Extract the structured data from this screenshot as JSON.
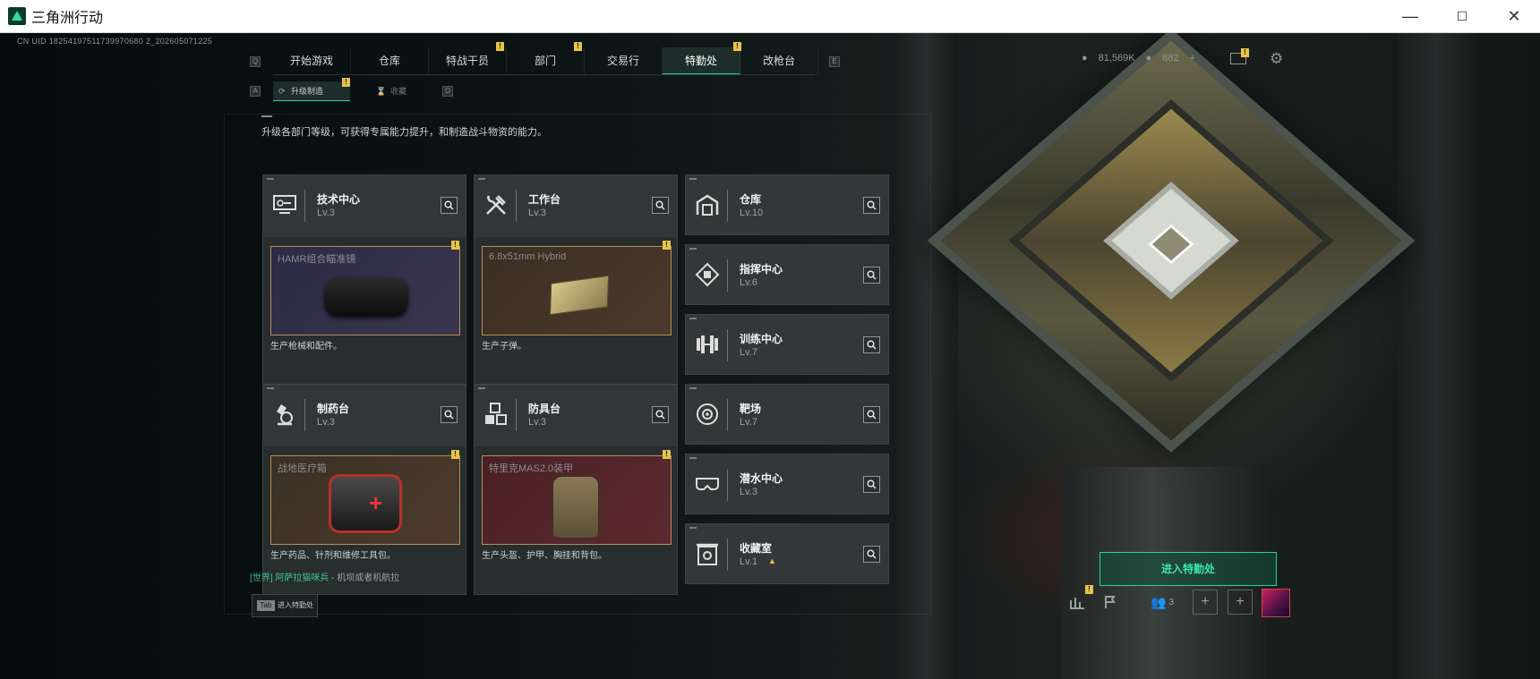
{
  "window": {
    "title": "三角洲行动",
    "minimize": "—",
    "maximize": "☐",
    "close": "✕"
  },
  "uid_text": "CN UID 18254197511739970680 2_202605071225",
  "nav": {
    "left_key": "Q",
    "right_key": "E",
    "tabs": [
      {
        "label": "开始游戏",
        "badge": ""
      },
      {
        "label": "仓库",
        "badge": ""
      },
      {
        "label": "特战干员",
        "badge": "!"
      },
      {
        "label": "部门",
        "badge": "!"
      },
      {
        "label": "交易行",
        "badge": ""
      },
      {
        "label": "特勤处",
        "badge": "!"
      },
      {
        "label": "改枪台",
        "badge": ""
      }
    ],
    "active_tab": "特勤处"
  },
  "currency": {
    "coins": "81,569K",
    "tickets": "882",
    "plus": "+"
  },
  "subnav": {
    "left_key": "A",
    "right_key": "D",
    "upgrade": "升级制造",
    "favorite": "收藏"
  },
  "description": "升级各部门等级，可获得专属能力提升，和制造战斗物资的能力。",
  "stations": [
    {
      "name": "技术中心",
      "level": "Lv.3",
      "icon": "monitor-icon",
      "product": "HAMR组合瞄准镜",
      "product_desc": "生产枪械和配件。"
    },
    {
      "name": "工作台",
      "level": "Lv.3",
      "icon": "tools-icon",
      "product": "6.8x51mm Hybrid",
      "product_desc": "生产子弹。"
    },
    {
      "name": "仓库",
      "level": "Lv.10",
      "icon": "warehouse-icon"
    },
    {
      "name": "指挥中心",
      "level": "Lv.6",
      "icon": "command-icon"
    },
    {
      "name": "训练中心",
      "level": "Lv.7",
      "icon": "dumbbell-icon"
    },
    {
      "name": "制药台",
      "level": "Lv.3",
      "icon": "microscope-icon",
      "product": "战地医疗箱",
      "product_desc": "生产药品、针剂和维修工具包。"
    },
    {
      "name": "防具台",
      "level": "Lv.3",
      "icon": "cubes-icon",
      "product": "特里克MAS2.0装甲",
      "product_desc": "生产头盔、护甲、胸挂和背包。"
    },
    {
      "name": "靶场",
      "level": "Lv.7",
      "icon": "target-icon"
    },
    {
      "name": "潜水中心",
      "level": "Lv.3",
      "icon": "diving-mask-icon"
    },
    {
      "name": "收藏室",
      "level": "Lv.1",
      "icon": "vault-icon"
    }
  ],
  "enter_button": "进入特勤处",
  "chat": {
    "channel": "[世界]",
    "name": "阿萨拉猫咪兵",
    "separator": "-",
    "message": "机坝或者机航拉"
  },
  "tab_hint": {
    "key": "Tab",
    "label": "进入特勤处"
  },
  "bottom": {
    "friends_count": "3",
    "plus": "+"
  },
  "colors": {
    "accent": "#23d49a",
    "badge": "#e7c348"
  }
}
